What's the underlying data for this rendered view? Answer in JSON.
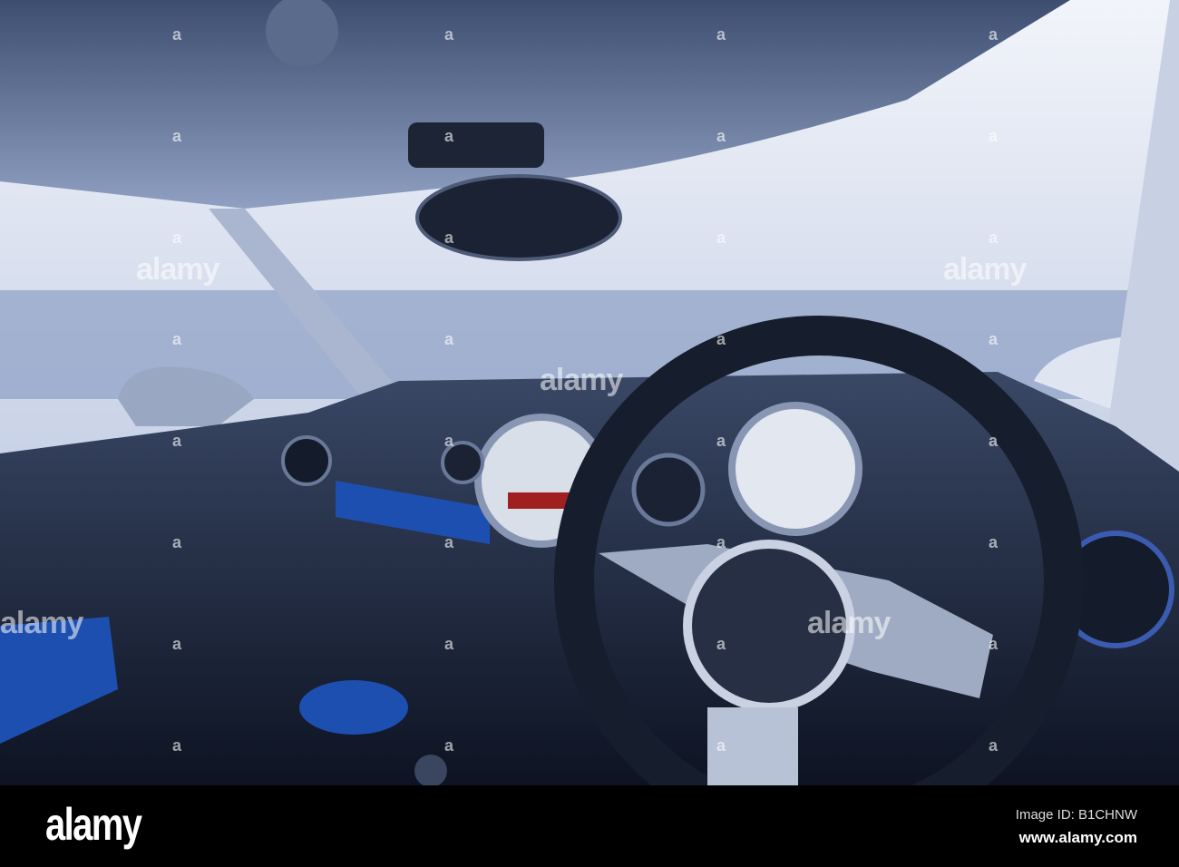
{
  "watermark": {
    "text": "alamy",
    "mark": "a"
  },
  "footer": {
    "logo": "alamy",
    "image_id": "Image ID: B1CHNW",
    "site": "www.alamy.com"
  },
  "colors": {
    "sky": "#e6ebf5",
    "interior": "#1a2438",
    "accent_blue": "#1d4fb0"
  }
}
